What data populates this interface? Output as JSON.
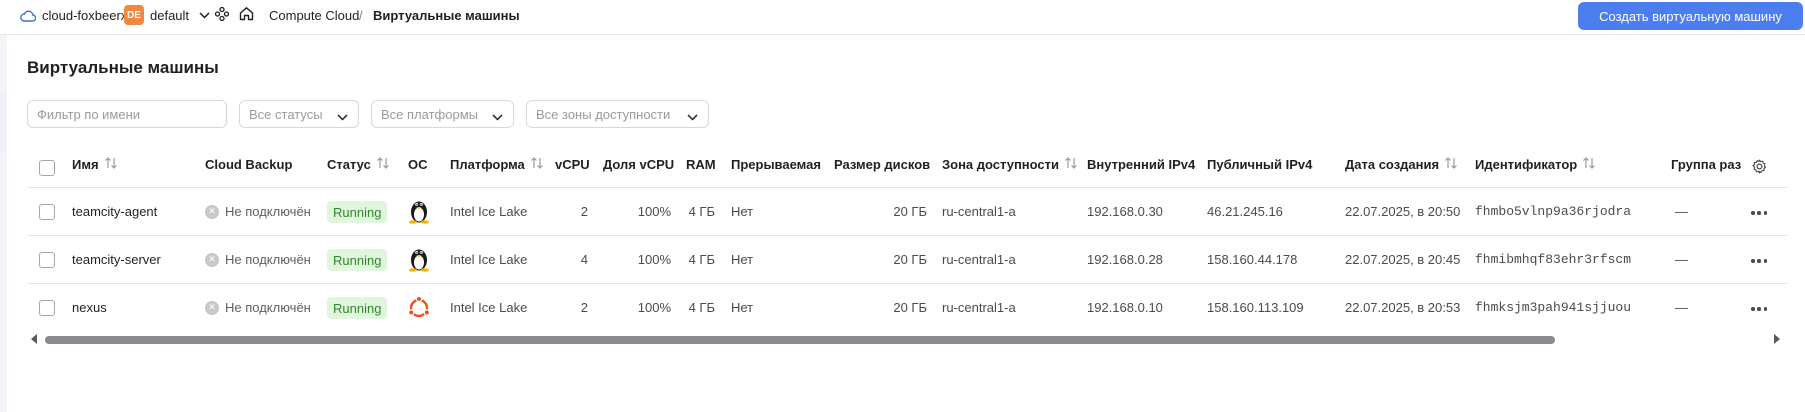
{
  "topbar": {
    "cloud_name": "cloud-foxbeerx",
    "folder_badge": "DE",
    "folder_name": "default",
    "breadcrumb_service": "Compute Cloud",
    "breadcrumb_separator": "/",
    "breadcrumb_current": "Виртуальные машины",
    "create_button": "Создать виртуальную машину"
  },
  "page": {
    "title": "Виртуальные машины"
  },
  "filters": {
    "name_placeholder": "Фильтр по имени",
    "status": "Все статусы",
    "platform": "Все платформы",
    "zone": "Все зоны доступности"
  },
  "table": {
    "columns": {
      "name": "Имя",
      "backup": "Cloud Backup",
      "status": "Статус",
      "os": "ОС",
      "platform": "Платформа",
      "vcpu": "vCPU",
      "vcpu_share": "Доля vCPU",
      "ram": "RAM",
      "preemptible": "Прерываемая",
      "disk_size": "Размер дисков",
      "zone": "Зона доступности",
      "internal_ip": "Внутренний IPv4",
      "public_ip": "Публичный IPv4",
      "created": "Дата создания",
      "id": "Идентификатор",
      "group": "Группа раз"
    },
    "rows": [
      {
        "name": "teamcity-agent",
        "backup": "Не подключён",
        "status": "Running",
        "os": "linux-tux-icon",
        "platform": "Intel Ice Lake",
        "vcpu": "2",
        "vcpu_share": "100%",
        "ram": "4 ГБ",
        "preemptible": "Нет",
        "disk_size": "20 ГБ",
        "zone": "ru-central1-a",
        "internal_ip": "192.168.0.30",
        "public_ip": "46.21.245.16",
        "created": "22.07.2025, в 20:50",
        "id": "fhmbo5vlnp9a36rjodra",
        "group": "—"
      },
      {
        "name": "teamcity-server",
        "backup": "Не подключён",
        "status": "Running",
        "os": "linux-tux-icon",
        "platform": "Intel Ice Lake",
        "vcpu": "4",
        "vcpu_share": "100%",
        "ram": "4 ГБ",
        "preemptible": "Нет",
        "disk_size": "20 ГБ",
        "zone": "ru-central1-a",
        "internal_ip": "192.168.0.28",
        "public_ip": "158.160.44.178",
        "created": "22.07.2025, в 20:45",
        "id": "fhmibmhqf83ehr3rfscm",
        "group": "—"
      },
      {
        "name": "nexus",
        "backup": "Не подключён",
        "status": "Running",
        "os": "ubuntu-icon",
        "platform": "Intel Ice Lake",
        "vcpu": "2",
        "vcpu_share": "100%",
        "ram": "4 ГБ",
        "preemptible": "Нет",
        "disk_size": "20 ГБ",
        "zone": "ru-central1-a",
        "internal_ip": "192.168.0.10",
        "public_ip": "158.160.113.109",
        "created": "22.07.2025, в 20:53",
        "id": "fhmksjm3pah941sjjuou",
        "group": "—"
      }
    ]
  },
  "colors": {
    "accent": "#4d7ef0",
    "status_running_bg": "#e2f5df",
    "status_running_text": "#2d8a2a",
    "folder_badge": "#f0883e",
    "ubuntu": "#e95420"
  }
}
